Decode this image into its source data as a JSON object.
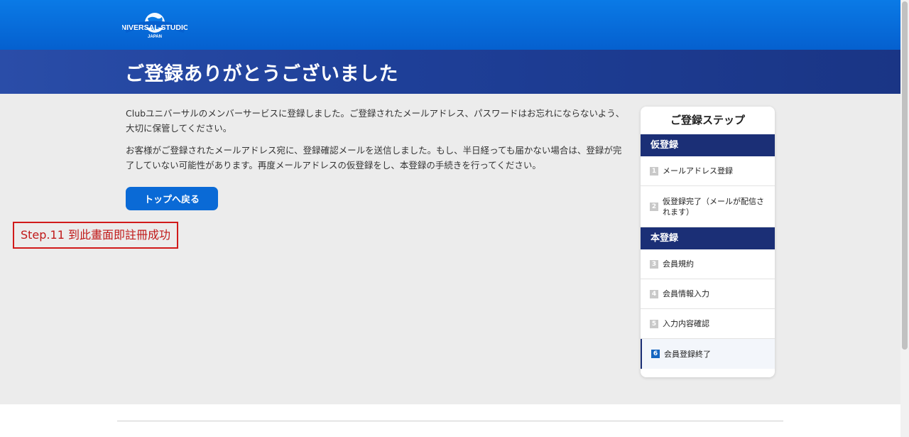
{
  "header": {
    "logo_icon": "universal-studios-globe-logo",
    "logo_text": "UNIVERSAL STUDIOS",
    "logo_subtext": "JAPAN",
    "title": "ご登録ありがとうございました"
  },
  "main": {
    "paragraph1": "Clubユニバーサルのメンバーサービスに登録しました。ご登録されたメールアドレス、パスワードはお忘れにならないよう、大切に保管してください。",
    "paragraph2": "お客様がご登録されたメールアドレス宛に、登録確認メールを送信しました。もし、半日経っても届かない場合は、登録が完了していない可能性があります。再度メールアドレスの仮登録をし、本登録の手続きを行ってください。",
    "back_button": "トップへ戻る"
  },
  "annotation": {
    "text": "Step.11 到此畫面即註冊成功",
    "color": "#d11a1a"
  },
  "steps": {
    "title": "ご登録ステップ",
    "groups": [
      {
        "label": "仮登録",
        "items": [
          {
            "num": "1",
            "label": "メールアドレス登録"
          },
          {
            "num": "2",
            "label": "仮登録完了（メールが配信されます）"
          }
        ]
      },
      {
        "label": "本登録",
        "items": [
          {
            "num": "3",
            "label": "会員規約"
          },
          {
            "num": "4",
            "label": "会員情報入力"
          },
          {
            "num": "5",
            "label": "入力内容確認"
          },
          {
            "num": "6",
            "label": "会員登録終了",
            "current": true
          }
        ]
      }
    ]
  },
  "colors": {
    "header_blue": "#0a7ae6",
    "hero_navy": "#1e3f98",
    "step_group_navy": "#1b2f76",
    "button_blue": "#0a6ad6"
  }
}
